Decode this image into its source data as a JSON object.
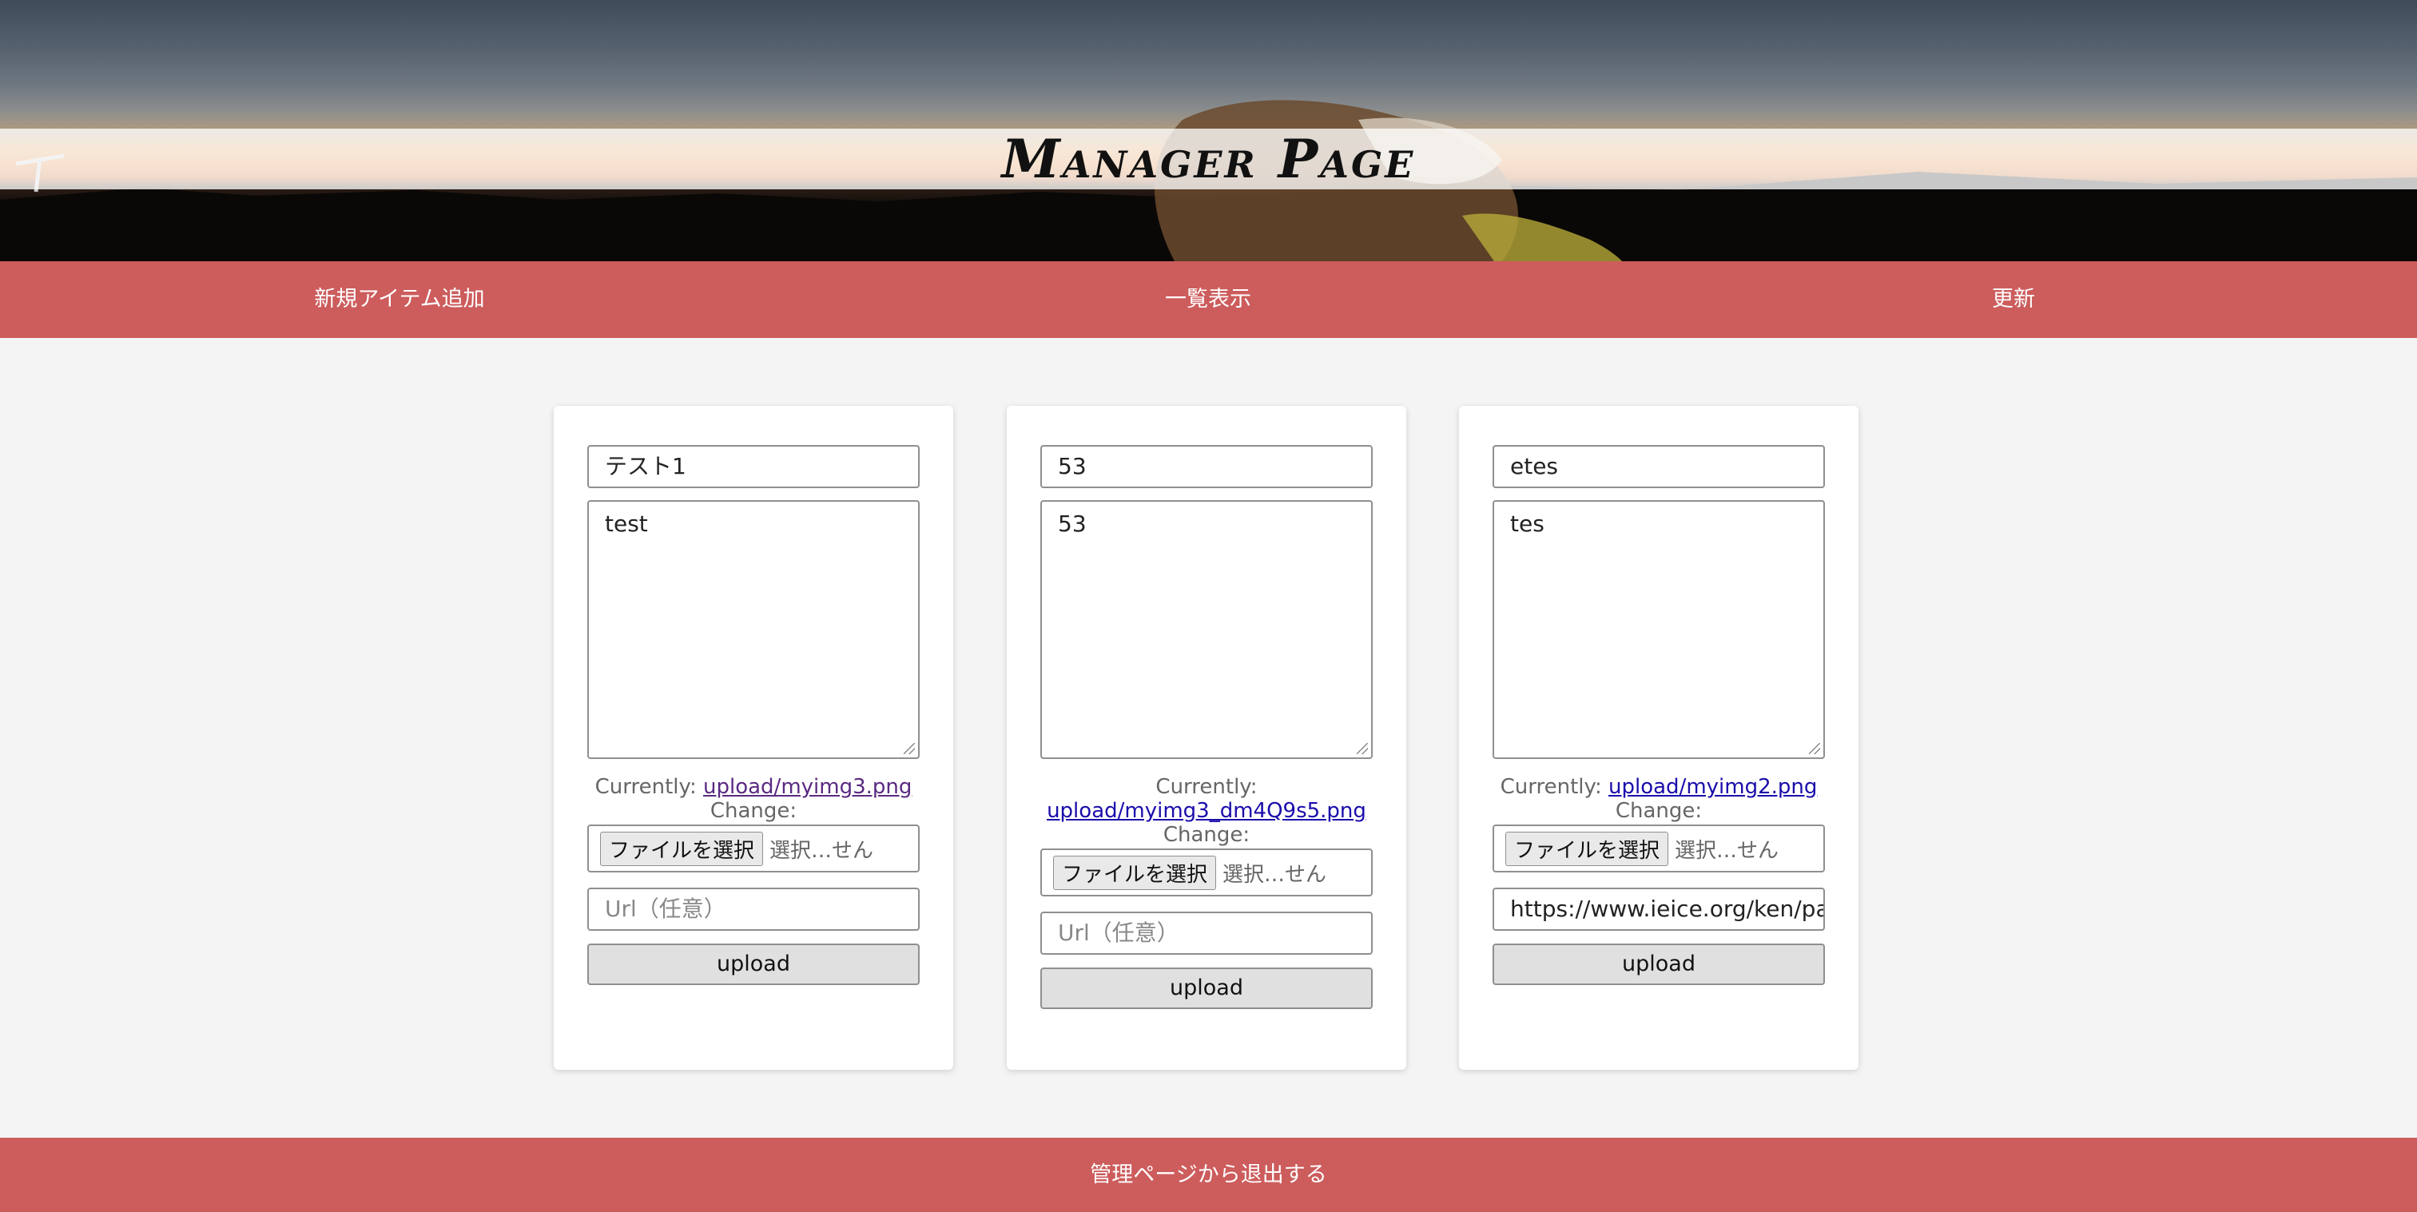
{
  "header": {
    "title": "Manager Page"
  },
  "nav": {
    "items": [
      {
        "label": "新規アイテム追加"
      },
      {
        "label": "一覧表示"
      },
      {
        "label": "更新"
      }
    ]
  },
  "cards": [
    {
      "title_value": "テスト1",
      "description_value": "test",
      "currently_label": "Currently:",
      "current_file": "upload/myimg3.png",
      "change_label": "Change:",
      "file_button": "ファイルを選択",
      "file_status": "選択…せん",
      "url_value": "",
      "url_placeholder": "Url（任意）",
      "upload_label": "upload"
    },
    {
      "title_value": "53",
      "description_value": "53",
      "currently_label": "Currently:",
      "current_file": "upload/myimg3_dm4Q9s5.png",
      "change_label": "Change:",
      "file_button": "ファイルを選択",
      "file_status": "選択…せん",
      "url_value": "",
      "url_placeholder": "Url（任意）",
      "upload_label": "upload"
    },
    {
      "title_value": "etes",
      "description_value": "tes",
      "currently_label": "Currently:",
      "current_file": "upload/myimg2.png",
      "change_label": "Change:",
      "file_button": "ファイルを選択",
      "file_status": "選択…せん",
      "url_value": "https://www.ieice.org/ken/pap",
      "url_placeholder": "Url（任意）",
      "upload_label": "upload"
    }
  ],
  "footer": {
    "logout_label": "管理ページから退出する"
  },
  "colors": {
    "accent": "#cd5c5c",
    "background": "#f4f4f4",
    "link": "#1a0dab",
    "visited_link": "#5a2a82"
  }
}
